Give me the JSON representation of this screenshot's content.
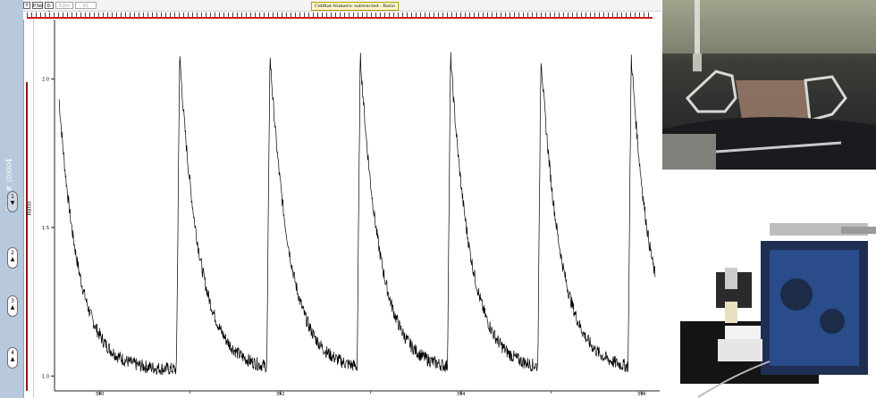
{
  "window": {
    "left_title": "Data-#_(0)004"
  },
  "toolbar": {
    "btn_1": "T",
    "btn_2": "P.Sel",
    "btn_3": "0-0",
    "btn_4": "Y.Zm",
    "btn_5": "X1 Sweep",
    "title": "CellRat-Numeric subtracted : Ratio"
  },
  "traces": [
    {
      "label": "1",
      "arrow": "▼"
    },
    {
      "label": "2",
      "arrow": "▲"
    },
    {
      "label": "3",
      "arrow": "▲"
    },
    {
      "label": "4",
      "arrow": "▲"
    }
  ],
  "axis": {
    "ylabel": "Ratio"
  },
  "colors": {
    "trace": "#000000",
    "accent": "#d11818",
    "sidebar": "#b9c9dd"
  },
  "chart_data": {
    "type": "line",
    "xlabel": "",
    "ylabel": "Ratio",
    "x_ticks": [
      "390",
      "392",
      "394",
      "396"
    ],
    "y_ticks": [
      "1.0",
      "1.5",
      "2.0"
    ],
    "xlim": [
      389.5,
      396.2
    ],
    "ylim": [
      0.95,
      2.2
    ],
    "peak_times": [
      390.85,
      391.85,
      392.85,
      393.85,
      394.85,
      395.85
    ],
    "baseline": 1.02,
    "peak": 2.08,
    "x_min": 389.55,
    "x_max": 396.15
  },
  "photos": {
    "top_icon": "microscope-view-photo",
    "bottom_icon": "stage-device-photo"
  }
}
